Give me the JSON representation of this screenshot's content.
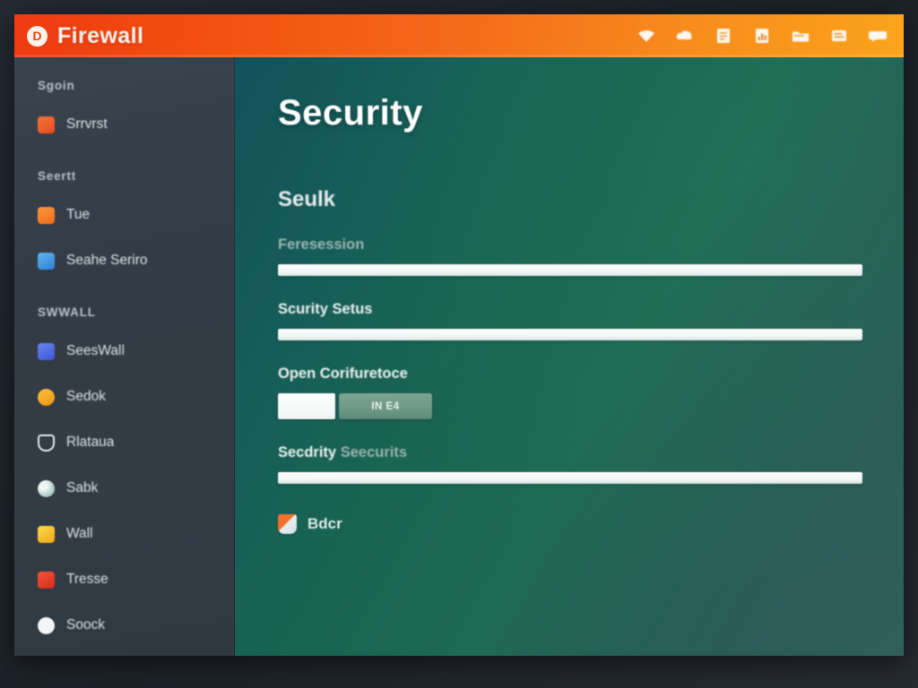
{
  "titlebar": {
    "app_name": "Firewall",
    "brand_mark": "D",
    "toolbar_icons": [
      {
        "name": "wifi-icon",
        "glyph": "wifi"
      },
      {
        "name": "cloud-icon",
        "glyph": "cloud"
      },
      {
        "name": "document-icon",
        "glyph": "document"
      },
      {
        "name": "chart-icon",
        "glyph": "chart"
      },
      {
        "name": "folder-icon",
        "glyph": "folder"
      },
      {
        "name": "list-icon",
        "glyph": "list"
      },
      {
        "name": "chat-icon",
        "glyph": "chat"
      }
    ]
  },
  "sidebar": {
    "sections": [
      {
        "header": "Sgoin",
        "items": [
          {
            "label": "Srrvrst",
            "icon": "ic-orange",
            "shape": "sq"
          }
        ]
      },
      {
        "header": "Seertt",
        "items": [
          {
            "label": "Tue",
            "icon": "ic-orange2",
            "shape": "sq"
          },
          {
            "label": "Seahe Seriro",
            "icon": "ic-blue",
            "shape": "sq"
          }
        ]
      },
      {
        "header": "SWWALL",
        "items": [
          {
            "label": "SeesWall",
            "icon": "ic-indigo",
            "shape": "sq"
          },
          {
            "label": "Sedok",
            "icon": "ic-amber",
            "shape": "circ"
          },
          {
            "label": "Rlataua",
            "icon": "ic-shield",
            "shape": "shield"
          },
          {
            "label": "Sabk",
            "icon": "ic-teal",
            "shape": "circ"
          },
          {
            "label": "Wall",
            "icon": "ic-yellow",
            "shape": "sq"
          },
          {
            "label": "Tresse",
            "icon": "ic-red",
            "shape": "sq"
          },
          {
            "label": "Soock",
            "icon": "ic-white",
            "shape": "circ"
          }
        ]
      }
    ]
  },
  "main": {
    "page_title": "Security",
    "section_title": "Seulk",
    "fields": [
      {
        "label": "Feresession",
        "value": "",
        "bright": false
      },
      {
        "label": "Scurity Setus",
        "value": "",
        "bright": true
      }
    ],
    "config": {
      "label": "Open Corifuretoce",
      "input_value": "",
      "button_label": "IN E4"
    },
    "last_field": {
      "label_primary": "Secdrity",
      "label_secondary": "Seecurits",
      "value": ""
    },
    "footer": {
      "label": "Bdcr",
      "icon": "shield-badge-icon"
    }
  },
  "colors": {
    "header_start": "#ef3a12",
    "header_end": "#faa41b",
    "sidebar_bg": "#333c46",
    "content_start": "#11535b",
    "content_end": "#31605c",
    "button_green": "#6f9a89"
  }
}
